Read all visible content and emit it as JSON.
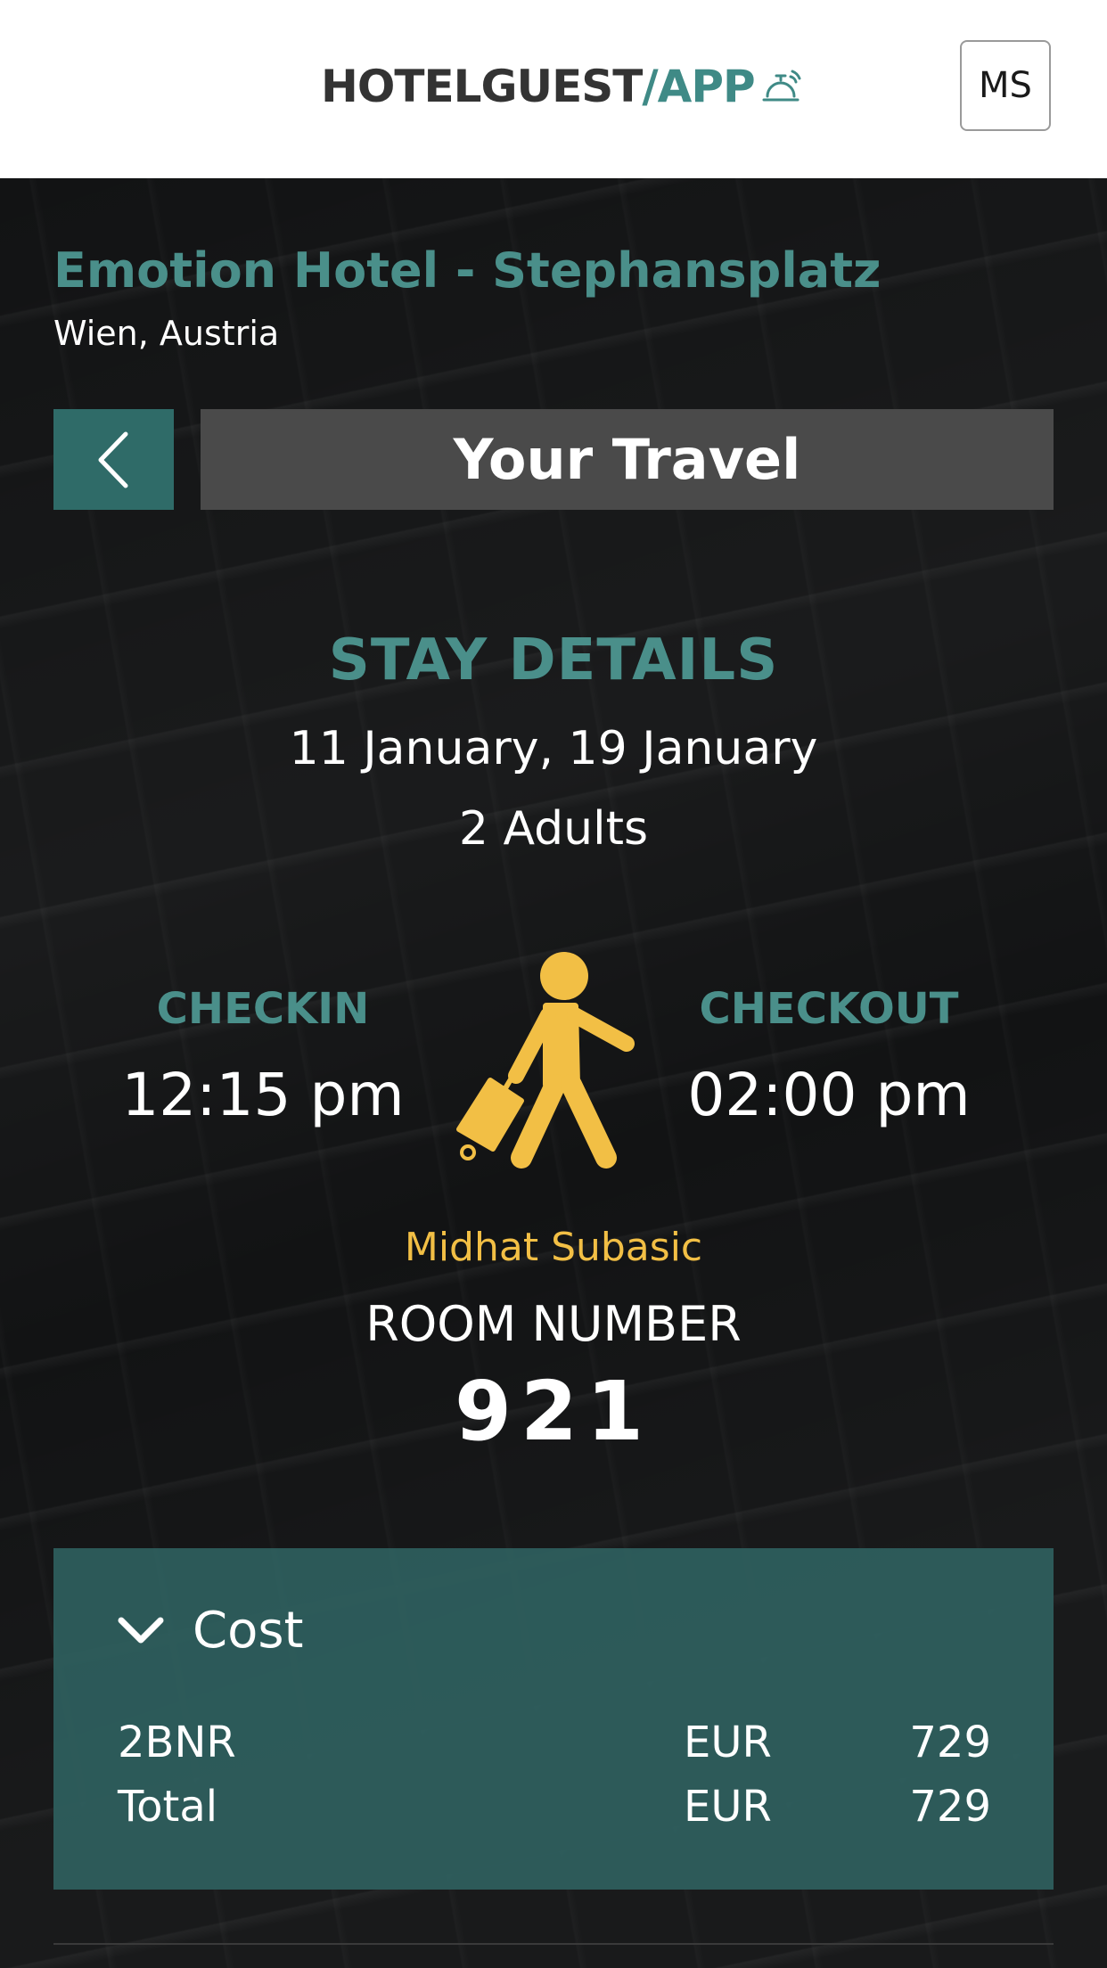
{
  "header": {
    "logo_part1": "HOTELGUEST",
    "logo_part2": "/APP",
    "logo_icon": "service-bell-icon",
    "avatar_initials": "MS"
  },
  "hotel": {
    "name": "Emotion Hotel - Stephansplatz",
    "location": "Wien, Austria"
  },
  "nav": {
    "back_icon": "chevron-left-icon",
    "title": "Your Travel"
  },
  "stay": {
    "heading": "STAY DETAILS",
    "dates": "11 January, 19 January",
    "guests": "2 Adults",
    "checkin_label": "CHECKIN",
    "checkin_time": "12:15 pm",
    "checkout_label": "CHECKOUT",
    "checkout_time": "02:00 pm",
    "traveler_icon": "traveler-with-luggage-icon",
    "guest_name": "Midhat Subasic",
    "room_label": "ROOM NUMBER",
    "room_number": "921"
  },
  "cost": {
    "title": "Cost",
    "toggle_icon": "chevron-down-icon",
    "rows": [
      {
        "label": "2BNR",
        "currency": "EUR",
        "amount": "729"
      },
      {
        "label": "Total",
        "currency": "EUR",
        "amount": "729"
      }
    ]
  },
  "colors": {
    "accent_teal": "#4a8f8a",
    "accent_yellow": "#f2bf45",
    "panel_teal": "#2f605e"
  }
}
